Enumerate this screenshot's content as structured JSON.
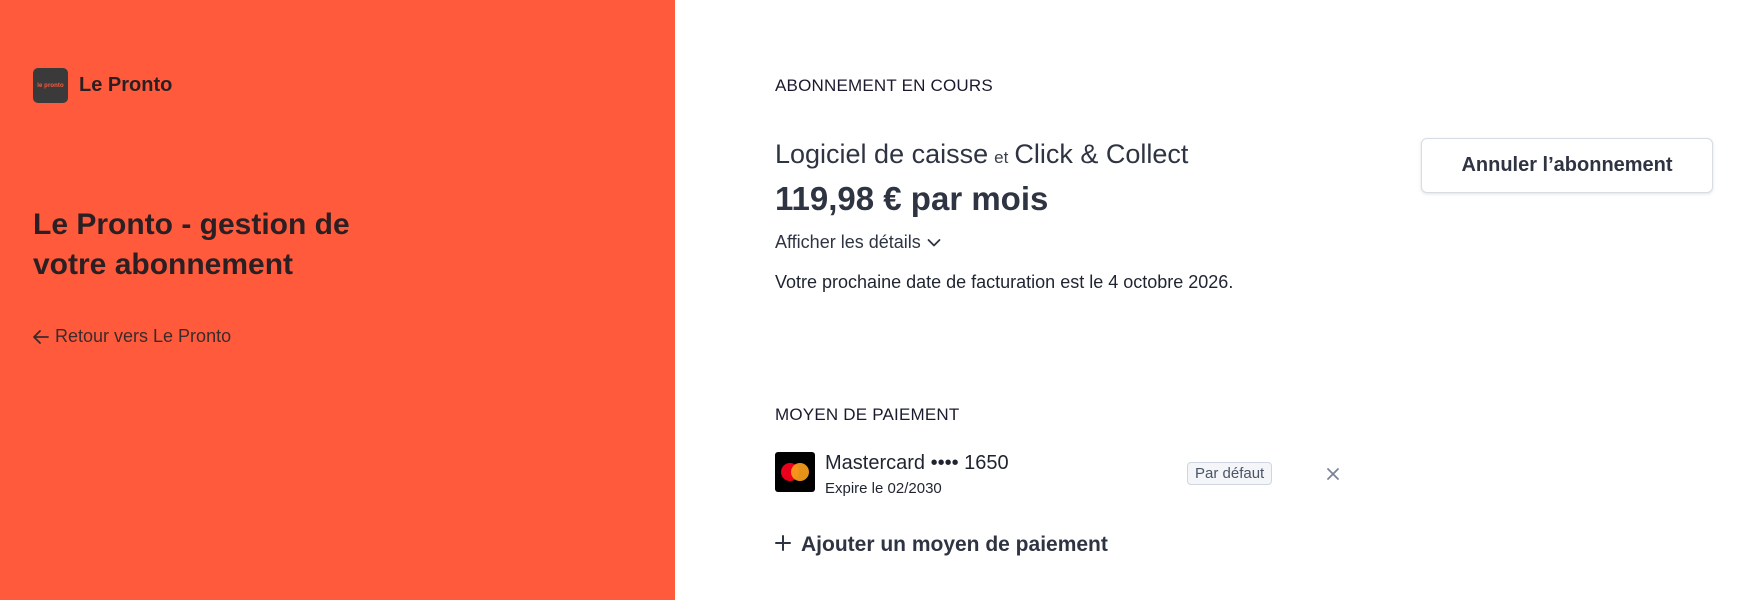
{
  "brand": {
    "name": "Le Pronto",
    "logo_text": "le pronto",
    "color": "#ff5a3c"
  },
  "hero": {
    "title": "Le Pronto - gestion de votre abonnement",
    "back_label": "Retour vers Le Pronto"
  },
  "subscription": {
    "section_label": "ABONNEMENT EN COURS",
    "plan_primary": "Logiciel de caisse",
    "plan_separator": "et",
    "plan_secondary": "Click & Collect",
    "price": "119,98 € par mois",
    "details_label": "Afficher les détails",
    "next_billing": "Votre prochaine date de facturation est le 4 octobre 2026.",
    "cancel_label": "Annuler l’abonnement"
  },
  "payment": {
    "section_label": "MOYEN DE PAIEMENT",
    "card": {
      "brand_icon": "mastercard-icon",
      "name": "Mastercard •••• 1650",
      "expiry": "Expire le 02/2030",
      "badge": "Par défaut"
    },
    "add_label": "Ajouter un moyen de paiement"
  }
}
